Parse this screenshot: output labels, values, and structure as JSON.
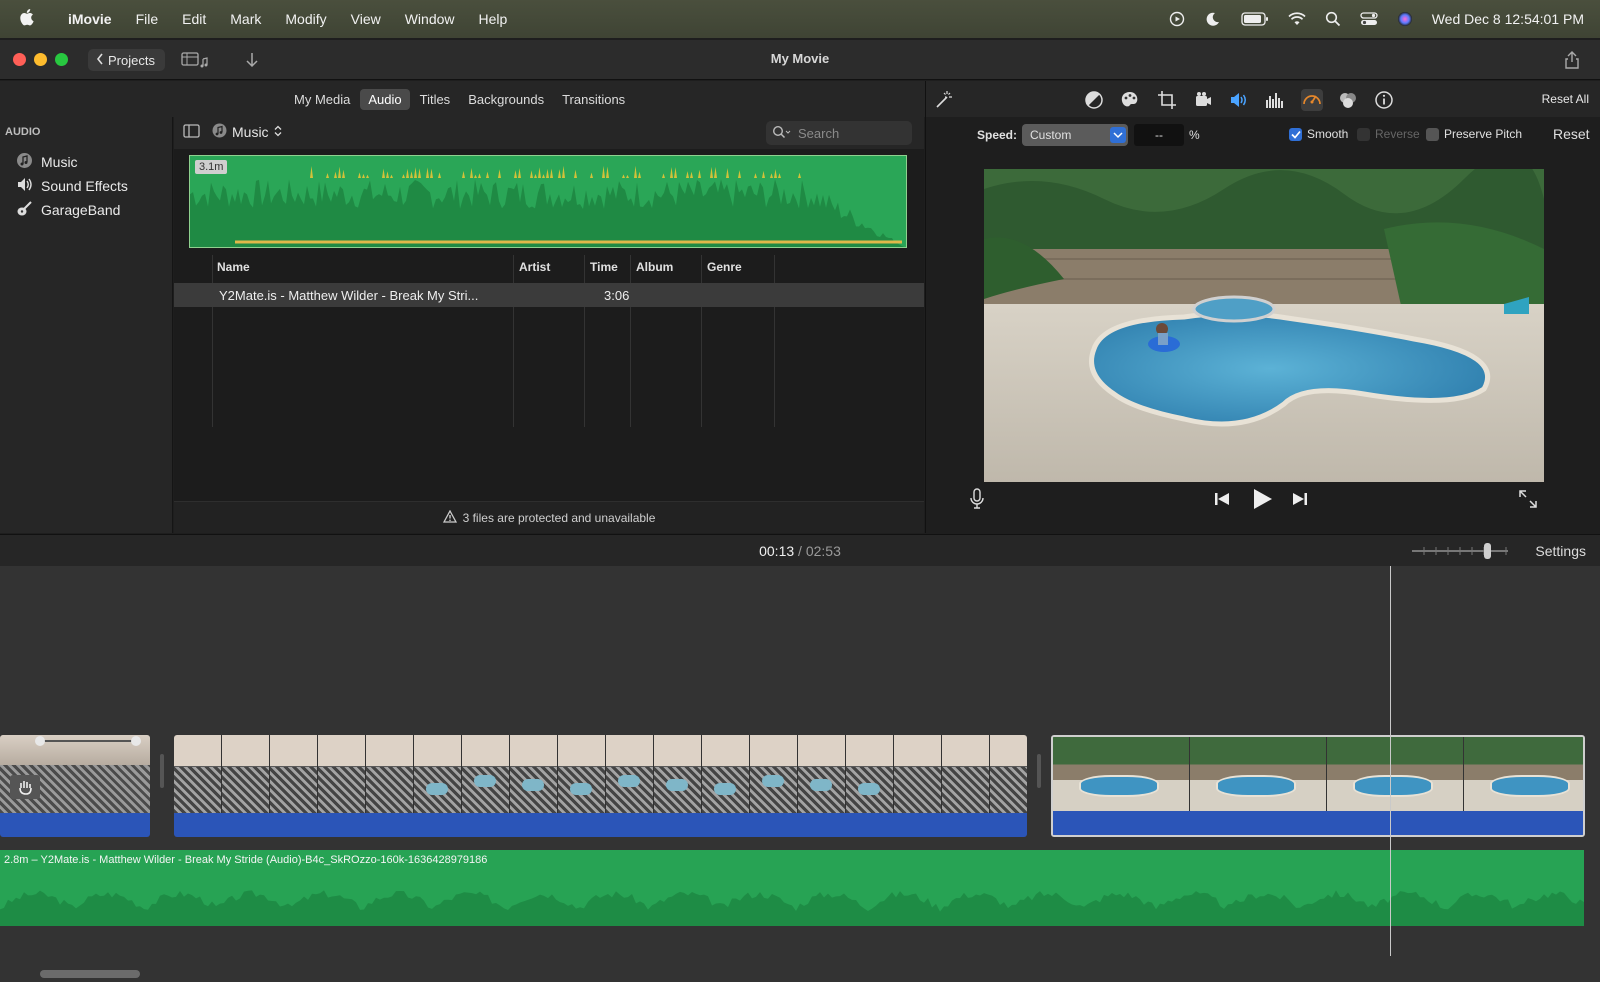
{
  "menubar": {
    "app": "iMovie",
    "items": [
      "File",
      "Edit",
      "Mark",
      "Modify",
      "View",
      "Window",
      "Help"
    ],
    "clock": "Wed Dec 8  12:54:01 PM"
  },
  "window": {
    "title": "My Movie",
    "projects_label": "Projects"
  },
  "browser": {
    "tabs": [
      "My Media",
      "Audio",
      "Titles",
      "Backgrounds",
      "Transitions"
    ],
    "active_tab": "Audio",
    "source_label": "Music",
    "search_placeholder": "Search"
  },
  "sidebar": {
    "header": "AUDIO",
    "items": [
      {
        "label": "Music",
        "icon": "music-note-icon"
      },
      {
        "label": "Sound Effects",
        "icon": "speaker-icon"
      },
      {
        "label": "GarageBand",
        "icon": "guitar-icon"
      }
    ]
  },
  "library": {
    "waveform_duration": "3.1m",
    "columns": [
      "Name",
      "Artist",
      "Time",
      "Album",
      "Genre"
    ],
    "rows": [
      {
        "name": "Y2Mate.is - Matthew Wilder - Break My Stri...",
        "artist": "",
        "time": "3:06",
        "album": "",
        "genre": ""
      }
    ],
    "status": "3 files are protected and unavailable"
  },
  "adjustments": {
    "reset_all": "Reset All",
    "speed_label": "Speed:",
    "speed_value": "Custom",
    "percent_value": "--",
    "percent_sign": "%",
    "smooth": {
      "label": "Smooth",
      "checked": true
    },
    "reverse": {
      "label": "Reverse",
      "checked": false
    },
    "preserve_pitch": {
      "label": "Preserve Pitch",
      "checked": false
    },
    "reset": "Reset"
  },
  "timeline": {
    "current_time": "00:13",
    "separator": "/",
    "total_time": "02:53",
    "settings_label": "Settings",
    "music_clip_label": "2.8m – Y2Mate.is - Matthew Wilder - Break My Stride (Audio)-B4c_SkROzzo-160k-1636428979186"
  },
  "colors": {
    "accent_blue": "#2f6fd6",
    "audio_green": "#27a354",
    "clip_audio_blue": "#2b55b8"
  }
}
